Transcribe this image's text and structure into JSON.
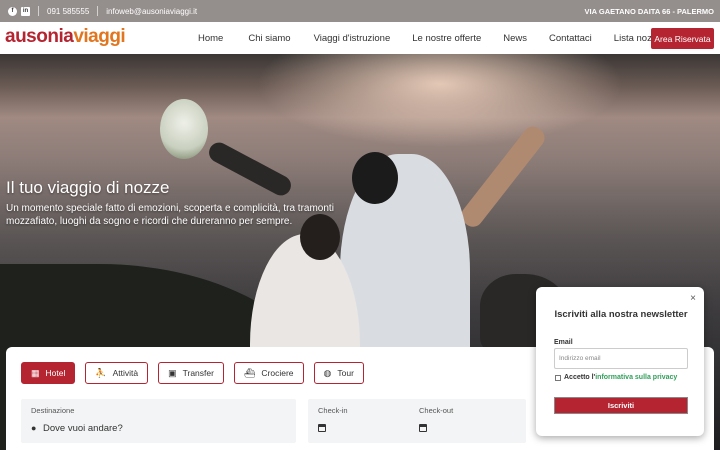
{
  "topbar": {
    "social": [
      {
        "icon": "facebook-icon",
        "glyph": "f"
      },
      {
        "icon": "linkedin-icon",
        "glyph": "in"
      }
    ],
    "phone": "091 585555",
    "email": "infoweb@ausoniaviaggi.it",
    "address": "VIA GAETANO DAITA 66 - PALERMO"
  },
  "header": {
    "logo_part1": "ausonia",
    "logo_part2": "viaggi",
    "nav": [
      "Home",
      "Chi siamo",
      "Viaggi d'istruzione",
      "Le nostre offerte",
      "News",
      "Contattaci",
      "Lista nozze"
    ],
    "area_button": "Area Riservata"
  },
  "hero": {
    "title": "Il tuo viaggio di nozze",
    "subtitle": "Un momento speciale fatto di emozioni, scoperta e complicità, tra tramonti mozzafiato, luoghi da sogno e ricordi che dureranno per sempre."
  },
  "booking": {
    "tabs": [
      {
        "label": "Hotel",
        "icon": "hotel-icon",
        "glyph": "▦",
        "active": true
      },
      {
        "label": "Attività",
        "icon": "hiking-icon",
        "glyph": "⛹",
        "active": false
      },
      {
        "label": "Transfer",
        "icon": "bus-icon",
        "glyph": "▣",
        "active": false
      },
      {
        "label": "Crociere",
        "icon": "ship-icon",
        "glyph": "⛴",
        "active": false
      },
      {
        "label": "Tour",
        "icon": "globe-icon",
        "glyph": "◍",
        "active": false
      }
    ],
    "destination_label": "Destinazione",
    "destination_placeholder": "Dove vuoi andare?",
    "checkin_label": "Check-in",
    "checkout_label": "Check-out"
  },
  "newsletter": {
    "close": "×",
    "title": "Iscriviti alla nostra newsletter",
    "email_label": "Email",
    "email_placeholder": "Indirizzo email",
    "privacy_text": "Accetto l'",
    "privacy_link": "informativa sulla privacy",
    "submit": "Iscriviti"
  },
  "colors": {
    "brand_red": "#b52431",
    "brand_orange": "#e2761f",
    "link_green": "#2f9e5a"
  }
}
